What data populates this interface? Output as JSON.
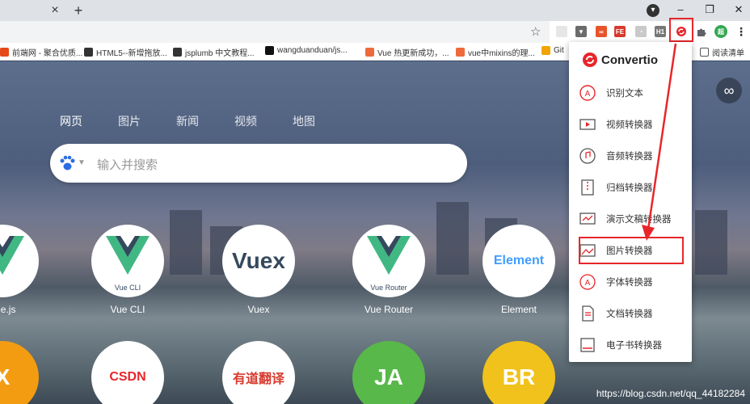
{
  "chrome": {
    "tab_close": "×",
    "new_tab": "+",
    "win_down": "▾",
    "win_min": "–",
    "win_restore": "❐",
    "win_close": "✕",
    "star": "☆",
    "profile_letter": "超",
    "menu": "⋮"
  },
  "extensions": [
    {
      "label": "",
      "color": "#e6e6e6"
    },
    {
      "label": "▼",
      "color": "#6b6b6b"
    },
    {
      "label": "∞",
      "color": "#e8532a"
    },
    {
      "label": "FE",
      "color": "#d73a2e"
    },
    {
      "label": "◔",
      "color": "#c9c9c9"
    },
    {
      "label": "H1",
      "color": "#777777"
    }
  ],
  "bookmarks": [
    {
      "text": "前端网 - 聚合优质...",
      "color": "#e64a19"
    },
    {
      "text": "HTML5--新增拖放...",
      "color": "#333333"
    },
    {
      "text": "jsplumb 中文教程...",
      "color": "#333333"
    },
    {
      "text": "wangduanduan/js...",
      "color": "#111111"
    },
    {
      "text": "Vue 热更新成功，...",
      "color": "#ee6a3c"
    },
    {
      "text": "vue中mixins的理...",
      "color": "#ee6a3c"
    },
    {
      "text": "Git",
      "color": "#f0a500"
    }
  ],
  "reading_list": "阅读清单",
  "hero": {
    "nav": [
      "网页",
      "图片",
      "新闻",
      "视频",
      "地图"
    ],
    "search_placeholder": "输入并搜索",
    "infinity": "∞",
    "tiles_row1": [
      {
        "label": "Vue.js",
        "logo": "vue"
      },
      {
        "label": "Vue CLI",
        "logo": "vue",
        "sub": "Vue CLI"
      },
      {
        "label": "Vuex",
        "logo": "text",
        "text": "Vuex"
      },
      {
        "label": "Vue Router",
        "logo": "vue",
        "sub": "Vue Router"
      },
      {
        "label": "Element",
        "logo": "text",
        "text": "Element"
      }
    ],
    "tiles_row2": [
      {
        "text": "X"
      },
      {
        "text": "CSDN"
      },
      {
        "text": "有道翻译"
      },
      {
        "text": "JA"
      },
      {
        "text": "BR"
      }
    ],
    "watermark": "https://blog.csdn.net/qq_44182284"
  },
  "convertio": {
    "brand": "Convertio",
    "items": [
      {
        "label": "识别文本",
        "icon": "ocr-icon"
      },
      {
        "label": "视频转换器",
        "icon": "video-icon"
      },
      {
        "label": "音频转换器",
        "icon": "audio-icon"
      },
      {
        "label": "归档转换器",
        "icon": "archive-icon"
      },
      {
        "label": "演示文稿转换器",
        "icon": "presentation-icon"
      },
      {
        "label": "图片转换器",
        "icon": "image-icon"
      },
      {
        "label": "字体转换器",
        "icon": "font-icon"
      },
      {
        "label": "文档转换器",
        "icon": "document-icon"
      },
      {
        "label": "电子书转换器",
        "icon": "ebook-icon"
      }
    ]
  },
  "colors": {
    "highlight": "#e8262a",
    "vue_green": "#41b883",
    "vue_dark": "#35495e",
    "element_blue": "#409eff"
  }
}
